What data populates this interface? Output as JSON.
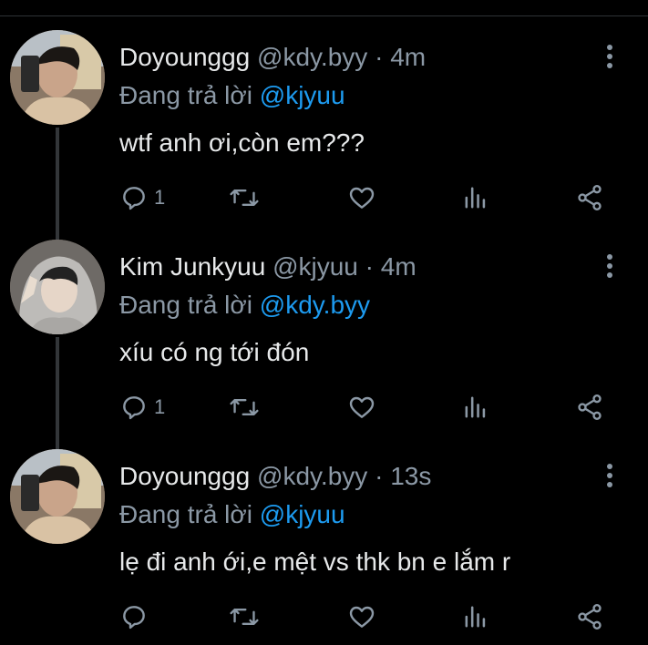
{
  "tweets": [
    {
      "display_name": "Doyounggg",
      "handle": "@kdy.byy",
      "separator": "·",
      "time": "4m",
      "reply_prefix": "Đang trả lời",
      "reply_to": "@kjyuu",
      "text": "wtf anh ơi,còn em???",
      "reply_count": "1"
    },
    {
      "display_name": "Kim Junkyuu",
      "handle": "@kjyuu",
      "separator": "·",
      "time": "4m",
      "reply_prefix": "Đang trả lời",
      "reply_to": "@kdy.byy",
      "text": "xíu có ng tới đón",
      "reply_count": "1"
    },
    {
      "display_name": "Doyounggg",
      "handle": "@kdy.byy",
      "separator": "·",
      "time": "13s",
      "reply_prefix": "Đang trả lời",
      "reply_to": "@kjyuu",
      "text": "lẹ đi anh ới,e mệt vs thk bn e lắm r",
      "reply_count": ""
    }
  ],
  "colors": {
    "background": "#000000",
    "primary_text": "#e7e9ea",
    "secondary_text": "#8b98a5",
    "mention": "#1d9bf0",
    "thread_line": "#333639"
  },
  "icons": [
    "reply-icon",
    "retweet-icon",
    "like-icon",
    "views-icon",
    "share-icon",
    "more-icon"
  ]
}
